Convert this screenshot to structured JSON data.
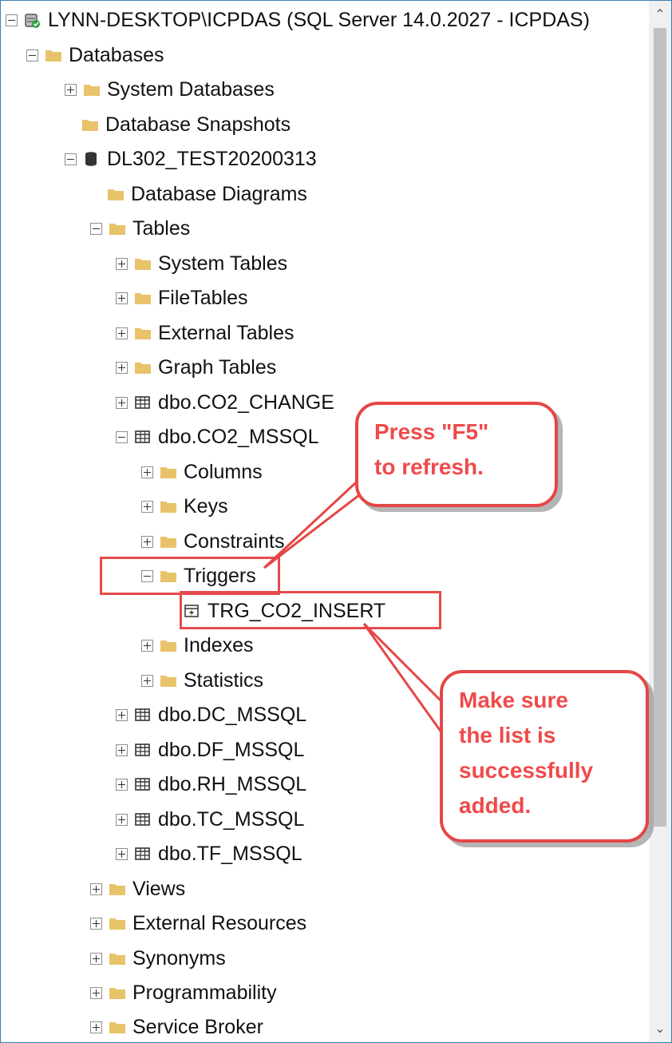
{
  "tree": {
    "server": {
      "label": "LYNN-DESKTOP\\ICPDAS (SQL Server 14.0.2027 - ICPDAS)",
      "icon": "server-icon"
    },
    "databases": {
      "label": "Databases"
    },
    "system_databases": {
      "label": "System Databases"
    },
    "database_snapshots": {
      "label": "Database Snapshots"
    },
    "db": {
      "label": "DL302_TEST20200313",
      "icon": "database-icon"
    },
    "database_diagrams": {
      "label": "Database Diagrams"
    },
    "tables": {
      "label": "Tables"
    },
    "system_tables": {
      "label": "System Tables"
    },
    "filetables": {
      "label": "FileTables"
    },
    "external_tables": {
      "label": "External Tables"
    },
    "graph_tables": {
      "label": "Graph Tables"
    },
    "co2_change": {
      "label": "dbo.CO2_CHANGE"
    },
    "co2_mssql": {
      "label": "dbo.CO2_MSSQL"
    },
    "columns": {
      "label": "Columns"
    },
    "keys": {
      "label": "Keys"
    },
    "constraints": {
      "label": "Constraints"
    },
    "triggers": {
      "label": "Triggers"
    },
    "trg_co2_insert": {
      "label": "TRG_CO2_INSERT",
      "icon": "trigger-icon"
    },
    "indexes": {
      "label": "Indexes"
    },
    "statistics": {
      "label": "Statistics"
    },
    "dc_mssql": {
      "label": "dbo.DC_MSSQL"
    },
    "df_mssql": {
      "label": "dbo.DF_MSSQL"
    },
    "rh_mssql": {
      "label": "dbo.RH_MSSQL"
    },
    "tc_mssql": {
      "label": "dbo.TC_MSSQL"
    },
    "tf_mssql": {
      "label": "dbo.TF_MSSQL"
    },
    "views": {
      "label": "Views"
    },
    "external_resources": {
      "label": "External Resources"
    },
    "synonyms": {
      "label": "Synonyms"
    },
    "programmability": {
      "label": "Programmability"
    },
    "service_broker": {
      "label": "Service Broker"
    }
  },
  "callouts": {
    "refresh": "Press \"F5\"\nto refresh.",
    "verify": "Make sure\nthe list is\nsuccessfully\nadded."
  },
  "colors": {
    "folder": "#e8c36a",
    "annotation_red": "#e54646",
    "frame_border": "#3c7fb1"
  }
}
